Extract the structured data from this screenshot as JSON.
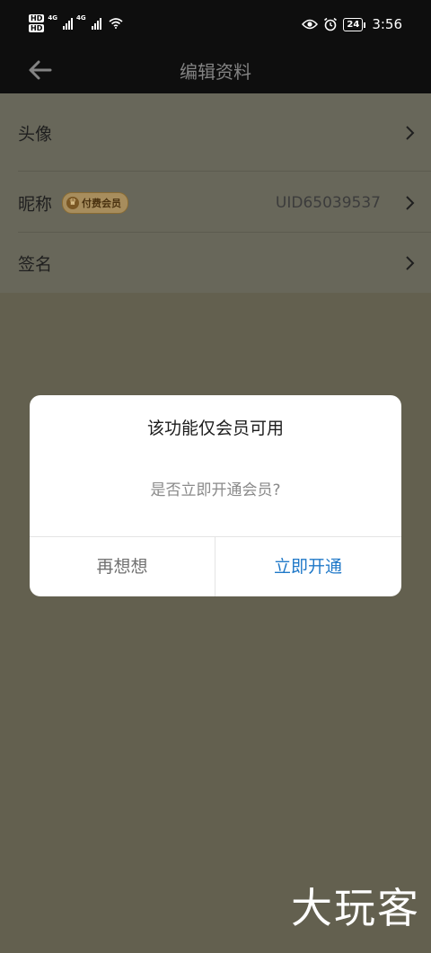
{
  "status_bar": {
    "hd1": "HD",
    "hd2": "HD",
    "net1": "4G",
    "net2": "4G",
    "battery": "24",
    "time": "3:56"
  },
  "nav": {
    "title": "编辑资料",
    "back_icon": "arrow-left-icon"
  },
  "list": {
    "items": [
      {
        "label": "头像"
      },
      {
        "label": "昵称",
        "badge": "付费会员",
        "value": "UID65039537"
      },
      {
        "label": "签名"
      }
    ]
  },
  "dialog": {
    "title": "该功能仅会员可用",
    "message": "是否立即开通会员?",
    "cancel": "再想想",
    "confirm": "立即开通"
  },
  "watermark": "大玩客",
  "colors": {
    "accent": "#1f78c8",
    "overlay_bg": "#63604f"
  }
}
